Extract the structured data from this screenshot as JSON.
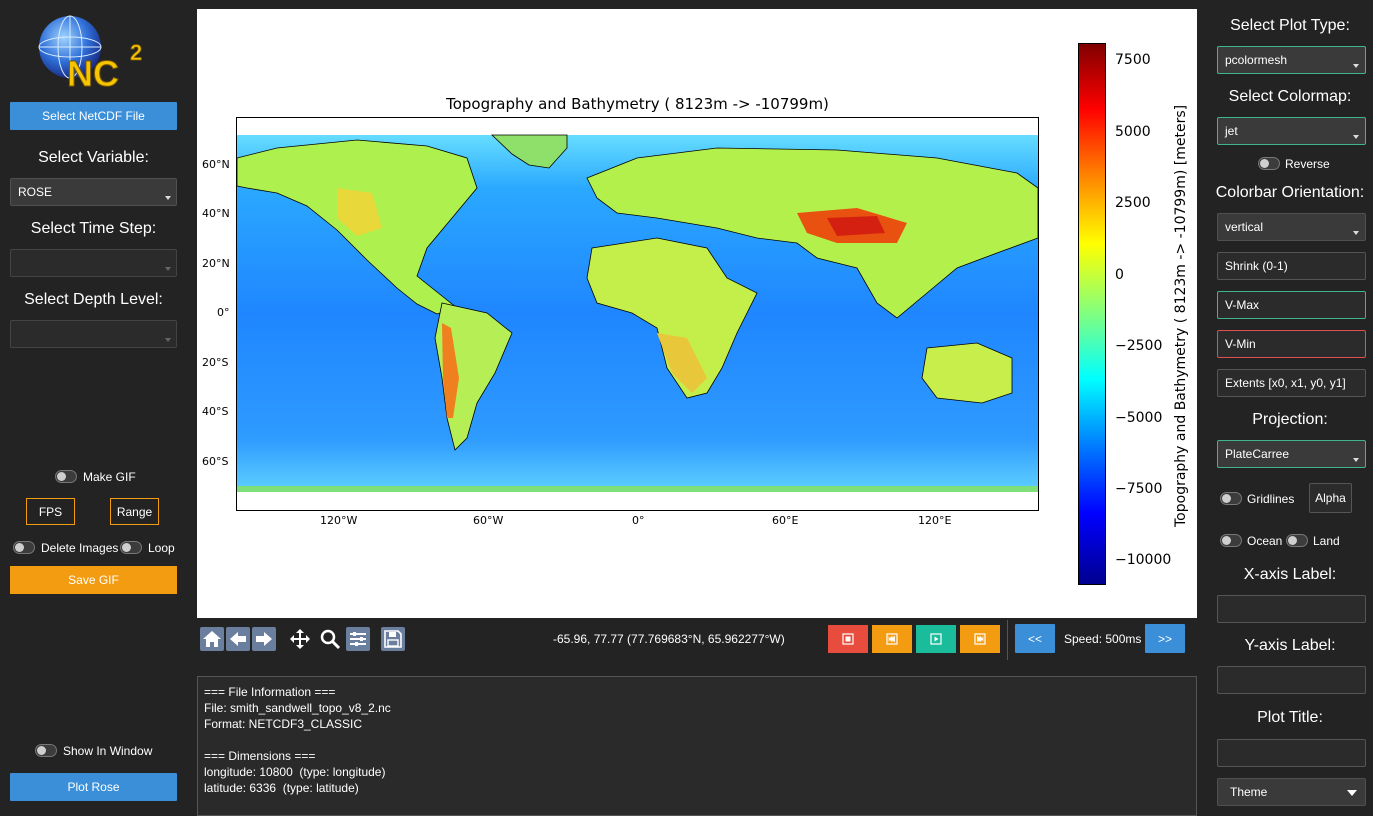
{
  "left": {
    "logo_text": "NC",
    "logo_sup": "2",
    "select_file": "Select NetCDF File",
    "select_variable_label": "Select Variable:",
    "variable_value": "ROSE",
    "select_time_label": "Select Time Step:",
    "select_depth_label": "Select Depth Level:",
    "make_gif": "Make GIF",
    "fps": "FPS",
    "range": "Range",
    "delete_images": "Delete Images",
    "loop": "Loop",
    "save_gif": "Save GIF",
    "show_in_window": "Show In Window",
    "plot_button": "Plot Rose"
  },
  "plot": {
    "title": "Topography and Bathymetry (  8123m -> -10799m)",
    "lat_ticks": [
      "60°N",
      "40°N",
      "20°N",
      "0°",
      "20°S",
      "40°S",
      "60°S"
    ],
    "lon_ticks": [
      "120°W",
      "60°W",
      "0°",
      "60°E",
      "120°E"
    ],
    "colorbar_ticks": [
      "7500",
      "5000",
      "2500",
      "0",
      "−2500",
      "−5000",
      "−7500",
      "−10000"
    ],
    "colorbar_label": "Topography and Bathymetry (  8123m -> -10799m) [meters]",
    "colormap": "jet"
  },
  "toolbar": {
    "coords": "-65.96, 77.77 (77.769683°N, 65.962277°W)",
    "speed": "Speed: 500ms",
    "prev": "<<",
    "next": ">>",
    "media_colors": {
      "stop": "#e74c3c",
      "rewind": "#f39c12",
      "play": "#1abc9c",
      "forward": "#f39c12"
    }
  },
  "info": {
    "text": "=== File Information ===\nFile: smith_sandwell_topo_v8_2.nc\nFormat: NETCDF3_CLASSIC\n\n=== Dimensions ===\nlongitude: 10800  (type: longitude)\nlatitude: 6336  (type: latitude)"
  },
  "right": {
    "plot_type_label": "Select Plot Type:",
    "plot_type_value": "pcolormesh",
    "colormap_label": "Select Colormap:",
    "colormap_value": "jet",
    "reverse": "Reverse",
    "orientation_label": "Colorbar Orientation:",
    "orientation_value": "vertical",
    "shrink_placeholder": "Shrink (0-1)",
    "vmax_placeholder": "V-Max",
    "vmin_placeholder": "V-Min",
    "extents_placeholder": "Extents [x0, x1, y0, y1]",
    "projection_label": "Projection:",
    "projection_value": "PlateCarree",
    "gridlines": "Gridlines",
    "alpha": "Alpha",
    "ocean": "Ocean",
    "land": "Land",
    "xaxis_label": "X-axis Label:",
    "yaxis_label": "Y-axis Label:",
    "plot_title_label": "Plot Title:",
    "theme": "Theme"
  }
}
